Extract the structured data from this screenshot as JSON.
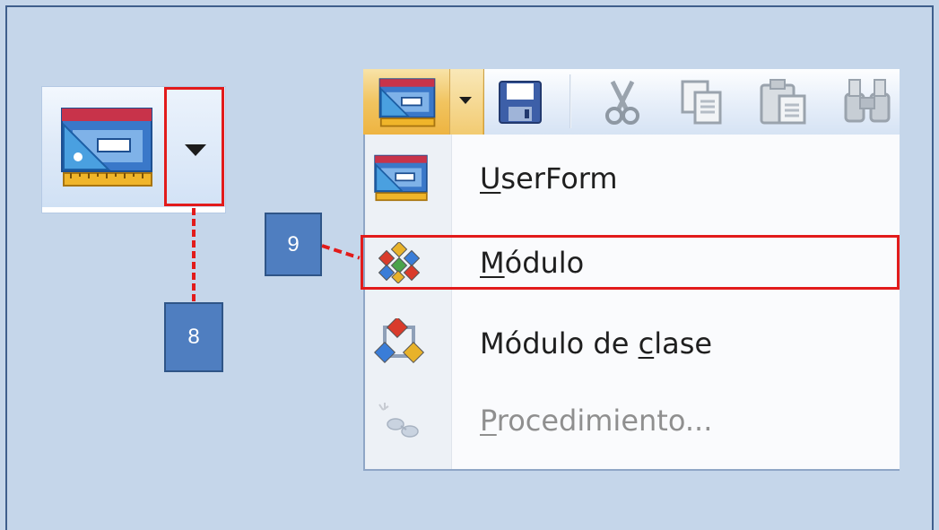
{
  "callouts": {
    "eight": "8",
    "nine": "9"
  },
  "menu": {
    "items": [
      {
        "pre": "",
        "accel": "U",
        "post": "serForm",
        "icon": "userform-icon",
        "enabled": true
      },
      {
        "pre": "",
        "accel": "M",
        "post": "ódulo",
        "icon": "module-icon",
        "enabled": true,
        "highlighted": true
      },
      {
        "pre": "Módulo de ",
        "accel": "c",
        "post": "lase",
        "icon": "class-module-icon",
        "enabled": true
      },
      {
        "pre": "",
        "accel": "P",
        "post": "rocedimiento...",
        "icon": "procedure-icon",
        "enabled": false
      }
    ]
  },
  "toolbar": {
    "icons": [
      "insert-userform-icon",
      "save-icon",
      "cut-icon",
      "copy-icon",
      "paste-icon",
      "find-icon"
    ]
  },
  "colors": {
    "highlight": "#e21b1b",
    "callout": "#4f7ec0",
    "background": "#c5d6ea"
  }
}
